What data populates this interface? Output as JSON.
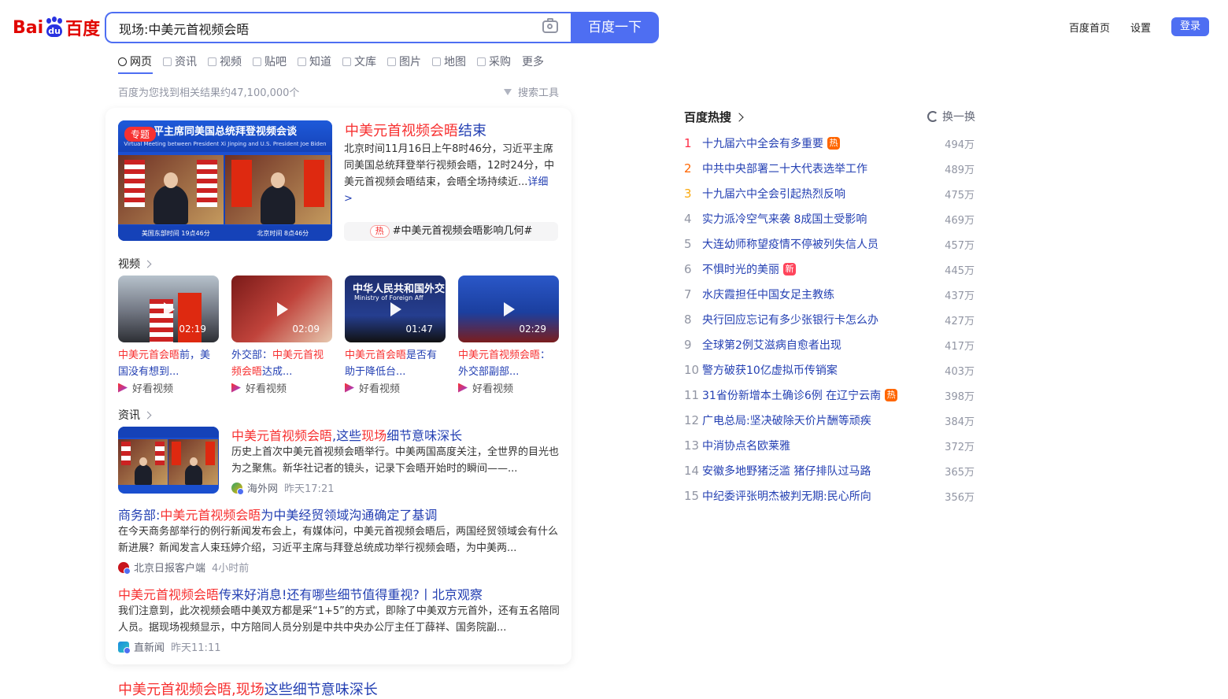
{
  "logo": {
    "part1": "Bai",
    "paw": "du",
    "part2": "百度"
  },
  "search": {
    "query": "现场:中美元首视频会晤",
    "button": "百度一下"
  },
  "toplinks": {
    "home": "百度首页",
    "settings": "设置",
    "login": "登录"
  },
  "tabs": [
    "网页",
    "资讯",
    "视频",
    "贴吧",
    "知道",
    "文库",
    "图片",
    "地图",
    "采购",
    "更多"
  ],
  "result_count": "百度为您找到相关结果约47,100,000个",
  "search_tools": "搜索工具",
  "hero": {
    "tag": "专题",
    "banner": "平主席同美国总统拜登视频会谈",
    "banner_sub": "Virtual Meeting between President Xi Jinping and U.S. President Joe Biden",
    "foot_left": "美国东部时间 19点46分",
    "foot_right": "北京时间 8点46分",
    "title_red": "中美元首视频会晤",
    "title_blue": "结束",
    "desc": "北京时间11月16日上午8时46分，习近平主席同美国总统拜登举行视频会晤，12时24分，中美元首视频会晤结束，会晤全场持续近...",
    "more": "详细 >",
    "hot_tag": "热",
    "hot_topic": "#中美元首视频会晤影响几何#"
  },
  "video_section": "视频",
  "videos": [
    {
      "duration": "02:19",
      "cap_red": "中美元首会晤",
      "cap_blue": "前，美国没有想到...",
      "source": "好看视频"
    },
    {
      "duration": "02:09",
      "cap_blue1": "外交部：",
      "cap_red": "中美元首视频会晤",
      "cap_blue": "达成...",
      "source": "好看视频"
    },
    {
      "duration": "01:47",
      "cap_red": "中美元首会晤",
      "cap_blue": "是否有助于降低台...",
      "source": "好看视频"
    },
    {
      "duration": "02:29",
      "cap_red": "中美元首视频会晤",
      "cap_blue": "：外交部副部...",
      "source": "好看视频"
    }
  ],
  "video_thumb_text": {
    "t3": "中华人民共和国外交",
    "t3b": "Ministry of Foreign Aff"
  },
  "news_section": "资讯",
  "news": [
    {
      "title_red1": "中美元首视频会晤",
      "title_blue1": ",这些",
      "title_red2": "现场",
      "title_blue2": "细节意味深长",
      "desc": "历史上首次中美元首视频会晤举行。中美两国高度关注，全世界的目光也为之聚焦。新华社记者的镜头，记录下会晤开始时的瞬间——...",
      "source": "海外网",
      "time": "昨天17:21"
    },
    {
      "title_blue1": "商务部:",
      "title_red1": "中美元首视频会晤",
      "title_blue2": "为中美经贸领域沟通确定了基调",
      "desc": "在今天商务部举行的例行新闻发布会上，有媒体问，中美元首视频会晤后，两国经贸领域会有什么新进展？新闻发言人束珏婷介绍，习近平主席与拜登总统成功举行视频会晤，为中美两...",
      "source": "北京日报客户端",
      "time": "4小时前"
    },
    {
      "title_red1": "中美元首视频会晤",
      "title_blue1": "传来好消息!还有哪些细节值得重视?丨北京观察",
      "desc": "我们注意到，此次视频会晤中美双方都是采“1+5”的方式，即除了中美双方元首外，还有五名陪同人员。据现场视频显示，中方陪同人员分别是中共中央办公厅主任丁薛祥、国务院副...",
      "source": "直新闻",
      "time": "昨天11:11"
    }
  ],
  "below": {
    "red": "中美元首视频会晤,",
    "red2": "现场",
    "blue": "这些细节意味深长"
  },
  "hot": {
    "header": "百度热搜",
    "refresh": "换一换",
    "items": [
      {
        "rank": "1",
        "text": "十九届六中全会有多重要",
        "badge": "热",
        "count": "494万"
      },
      {
        "rank": "2",
        "text": "中共中央部署二十大代表选举工作",
        "badge": "",
        "count": "489万"
      },
      {
        "rank": "3",
        "text": "十九届六中全会引起热烈反响",
        "badge": "",
        "count": "475万"
      },
      {
        "rank": "4",
        "text": "实力派冷空气来袭 8成国土受影响",
        "badge": "",
        "count": "469万"
      },
      {
        "rank": "5",
        "text": "大连幼师称望疫情不停被列失信人员",
        "badge": "",
        "count": "457万"
      },
      {
        "rank": "6",
        "text": "不惧时光的美丽",
        "badge": "新",
        "count": "445万"
      },
      {
        "rank": "7",
        "text": "水庆霞担任中国女足主教练",
        "badge": "",
        "count": "437万"
      },
      {
        "rank": "8",
        "text": "央行回应忘记有多少张银行卡怎么办",
        "badge": "",
        "count": "427万"
      },
      {
        "rank": "9",
        "text": "全球第2例艾滋病自愈者出现",
        "badge": "",
        "count": "417万"
      },
      {
        "rank": "10",
        "text": "警方破获10亿虚拟币传销案",
        "badge": "",
        "count": "403万"
      },
      {
        "rank": "11",
        "text": "31省份新增本土确诊6例 在辽宁云南",
        "badge": "热",
        "count": "398万"
      },
      {
        "rank": "12",
        "text": "广电总局:坚决破除天价片酬等顽疾",
        "badge": "",
        "count": "384万"
      },
      {
        "rank": "13",
        "text": "中消协点名欧莱雅",
        "badge": "",
        "count": "372万"
      },
      {
        "rank": "14",
        "text": "安徽多地野猪泛滥 猪仔排队过马路",
        "badge": "",
        "count": "365万"
      },
      {
        "rank": "15",
        "text": "中纪委评张明杰被判无期:民心所向",
        "badge": "",
        "count": "356万"
      }
    ]
  },
  "colors": {
    "accent": "#4e6ef2",
    "red": "#f73131",
    "link": "#2440b3"
  }
}
